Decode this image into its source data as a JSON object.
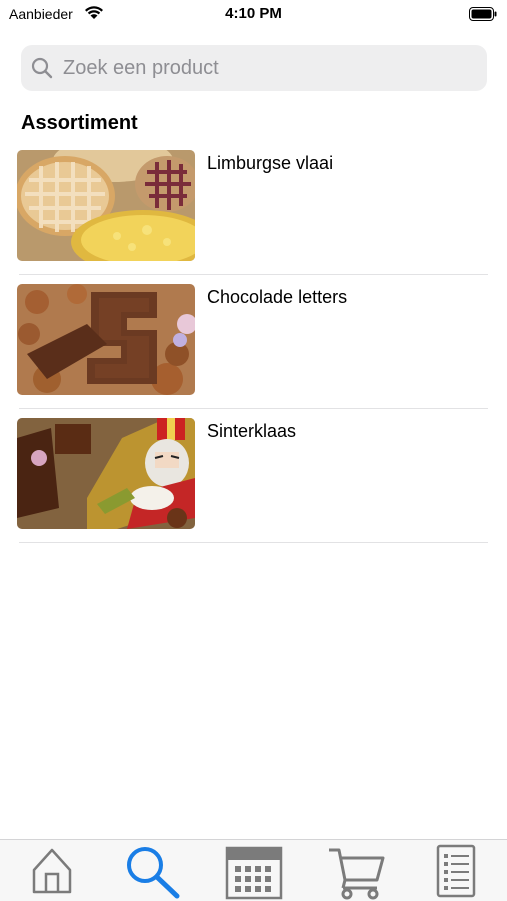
{
  "status_bar": {
    "carrier": "Aanbieder",
    "time": "4:10 PM"
  },
  "search": {
    "placeholder": "Zoek een product",
    "icon": "search-icon"
  },
  "section": {
    "title": "Assortiment"
  },
  "products": [
    {
      "name": "Limburgse vlaai",
      "image": "pies-photo"
    },
    {
      "name": "Chocolade letters",
      "image": "chocolate-letters-photo"
    },
    {
      "name": "Sinterklaas",
      "image": "sinterklaas-photo"
    }
  ],
  "tabbar": {
    "active": "search",
    "active_color": "#1a7ee6",
    "inactive_color": "#7b7b7b",
    "tabs": [
      {
        "id": "home",
        "icon": "home-icon"
      },
      {
        "id": "search",
        "icon": "search-icon"
      },
      {
        "id": "calendar",
        "icon": "calendar-icon"
      },
      {
        "id": "cart",
        "icon": "cart-icon"
      },
      {
        "id": "orders",
        "icon": "list-icon"
      }
    ]
  }
}
